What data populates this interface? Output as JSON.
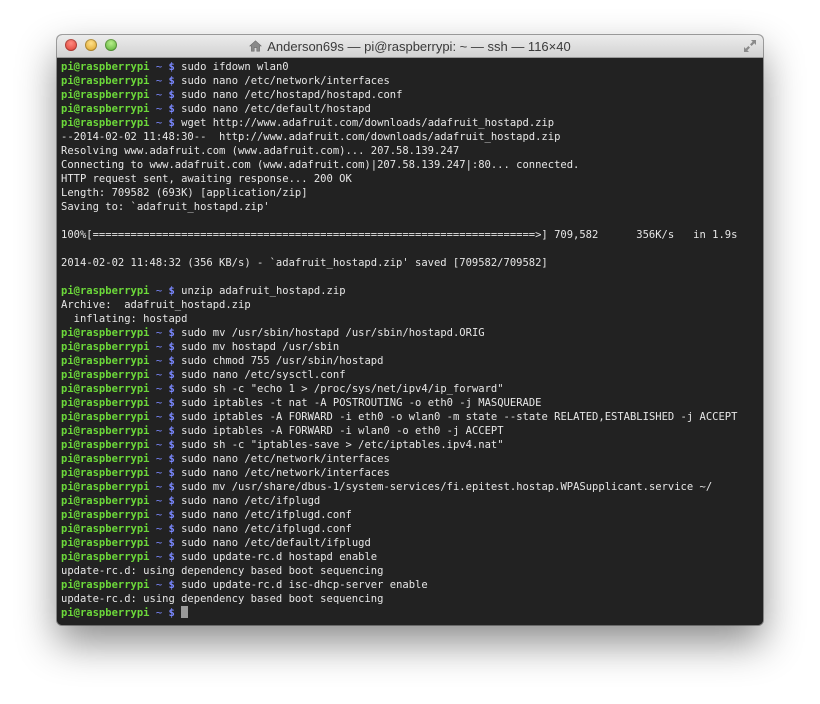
{
  "window": {
    "title": "Anderson69s — pi@raspberrypi: ~ — ssh — 116×40"
  },
  "prompt": {
    "host": "pi@raspberrypi",
    "path": "~",
    "symbol": "$"
  },
  "colors": {
    "background": "#222222",
    "host": "#6cd93a",
    "symbol": "#7a88ff",
    "text": "#e6e6e6"
  },
  "terminal": {
    "lines": [
      {
        "type": "cmd",
        "text": "sudo ifdown wlan0"
      },
      {
        "type": "cmd",
        "text": "sudo nano /etc/network/interfaces"
      },
      {
        "type": "cmd",
        "text": "sudo nano /etc/hostapd/hostapd.conf"
      },
      {
        "type": "cmd",
        "text": "sudo nano /etc/default/hostapd"
      },
      {
        "type": "cmd",
        "text": "wget http://www.adafruit.com/downloads/adafruit_hostapd.zip"
      },
      {
        "type": "out",
        "text": "--2014-02-02 11:48:30--  http://www.adafruit.com/downloads/adafruit_hostapd.zip"
      },
      {
        "type": "out",
        "text": "Resolving www.adafruit.com (www.adafruit.com)... 207.58.139.247"
      },
      {
        "type": "out",
        "text": "Connecting to www.adafruit.com (www.adafruit.com)|207.58.139.247|:80... connected."
      },
      {
        "type": "out",
        "text": "HTTP request sent, awaiting response... 200 OK"
      },
      {
        "type": "out",
        "text": "Length: 709582 (693K) [application/zip]"
      },
      {
        "type": "out",
        "text": "Saving to: `adafruit_hostapd.zip'"
      },
      {
        "type": "out",
        "text": ""
      },
      {
        "type": "out",
        "text": "100%[======================================================================>] 709,582      356K/s   in 1.9s"
      },
      {
        "type": "out",
        "text": ""
      },
      {
        "type": "out",
        "text": "2014-02-02 11:48:32 (356 KB/s) - `adafruit_hostapd.zip' saved [709582/709582]"
      },
      {
        "type": "out",
        "text": ""
      },
      {
        "type": "cmd",
        "text": "unzip adafruit_hostapd.zip"
      },
      {
        "type": "out",
        "text": "Archive:  adafruit_hostapd.zip"
      },
      {
        "type": "out",
        "text": "  inflating: hostapd"
      },
      {
        "type": "cmd",
        "text": "sudo mv /usr/sbin/hostapd /usr/sbin/hostapd.ORIG"
      },
      {
        "type": "cmd",
        "text": "sudo mv hostapd /usr/sbin"
      },
      {
        "type": "cmd",
        "text": "sudo chmod 755 /usr/sbin/hostapd"
      },
      {
        "type": "cmd",
        "text": "sudo nano /etc/sysctl.conf"
      },
      {
        "type": "cmd",
        "text": "sudo sh -c \"echo 1 > /proc/sys/net/ipv4/ip_forward\""
      },
      {
        "type": "cmd",
        "text": "sudo iptables -t nat -A POSTROUTING -o eth0 -j MASQUERADE"
      },
      {
        "type": "cmd",
        "text": "sudo iptables -A FORWARD -i eth0 -o wlan0 -m state --state RELATED,ESTABLISHED -j ACCEPT"
      },
      {
        "type": "cmd",
        "text": "sudo iptables -A FORWARD -i wlan0 -o eth0 -j ACCEPT"
      },
      {
        "type": "cmd",
        "text": "sudo sh -c \"iptables-save > /etc/iptables.ipv4.nat\""
      },
      {
        "type": "cmd",
        "text": "sudo nano /etc/network/interfaces"
      },
      {
        "type": "cmd",
        "text": "sudo nano /etc/network/interfaces"
      },
      {
        "type": "cmd",
        "text": "sudo mv /usr/share/dbus-1/system-services/fi.epitest.hostap.WPASupplicant.service ~/"
      },
      {
        "type": "cmd",
        "text": "sudo nano /etc/ifplugd"
      },
      {
        "type": "cmd",
        "text": "sudo nano /etc/ifplugd.conf"
      },
      {
        "type": "cmd",
        "text": "sudo nano /etc/ifplugd.conf"
      },
      {
        "type": "cmd",
        "text": "sudo nano /etc/default/ifplugd"
      },
      {
        "type": "cmd",
        "text": "sudo update-rc.d hostapd enable"
      },
      {
        "type": "out",
        "text": "update-rc.d: using dependency based boot sequencing"
      },
      {
        "type": "cmd",
        "text": "sudo update-rc.d isc-dhcp-server enable"
      },
      {
        "type": "out",
        "text": "update-rc.d: using dependency based boot sequencing"
      },
      {
        "type": "cursor",
        "text": ""
      }
    ]
  }
}
